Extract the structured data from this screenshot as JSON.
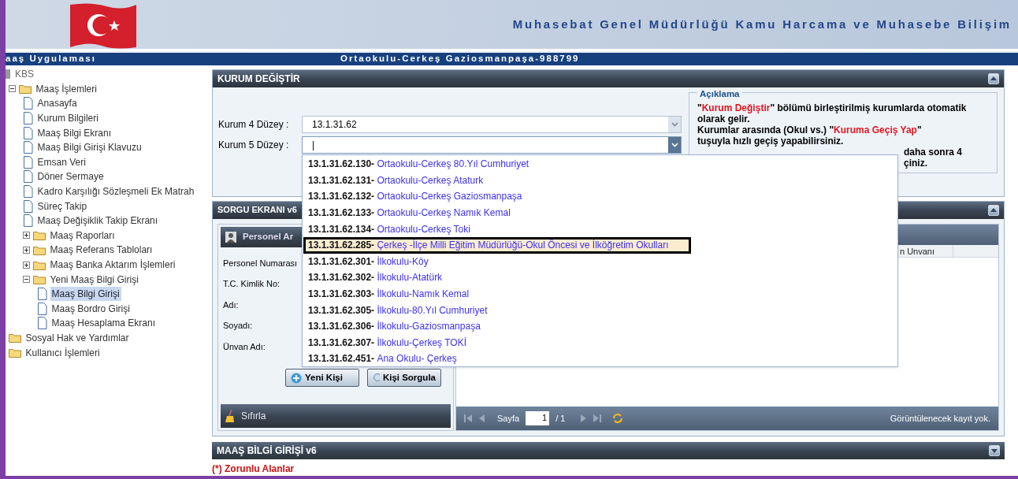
{
  "header": {
    "title": "Muhasebat Genel Müdürlüğü Kamu Harcama ve Muhasebe Bilişim"
  },
  "app_bar": {
    "app_name": "aaş Uygulaması",
    "institution": "Ortaokulu-Cerkeş Gaziosmanpaşa-988799"
  },
  "sidebar": {
    "tree": [
      {
        "label": "KBS",
        "kind": "root",
        "expanded": true,
        "children": [
          {
            "label": "Maaş İşlemleri",
            "kind": "folder",
            "expanded": true,
            "children": [
              {
                "label": "Anasayfa",
                "kind": "page",
                "selected": false
              },
              {
                "label": "Kurum Bilgileri",
                "kind": "page",
                "selected": false
              },
              {
                "label": "Maaş Bilgi Ekranı",
                "kind": "page",
                "selected": false
              },
              {
                "label": "Maaş Bilgi Girişi Klavuzu",
                "kind": "page",
                "selected": false
              },
              {
                "label": "Emsan Veri",
                "kind": "page",
                "selected": false
              },
              {
                "label": "Döner Sermaye",
                "kind": "page",
                "selected": false
              },
              {
                "label": "Kadro Karşılığı Sözleşmeli Ek Matrah",
                "kind": "page",
                "selected": false
              },
              {
                "label": "Süreç Takip",
                "kind": "page",
                "selected": false
              },
              {
                "label": "Maaş Değişiklik Takip Ekranı",
                "kind": "page",
                "selected": false
              },
              {
                "label": "Maaş Raporları",
                "kind": "folder",
                "expanded": false
              },
              {
                "label": "Maaş Referans Tabloları",
                "kind": "folder",
                "expanded": false
              },
              {
                "label": "Maaş Banka Aktarım İşlemleri",
                "kind": "folder",
                "expanded": false
              },
              {
                "label": "Yeni Maaş Bilgi Girişi",
                "kind": "folder",
                "expanded": true,
                "children": [
                  {
                    "label": "Maaş Bilgi Girişi",
                    "kind": "page",
                    "selected": true
                  },
                  {
                    "label": "Maaş Bordro Girişi",
                    "kind": "page",
                    "selected": false
                  },
                  {
                    "label": "Maaş Hesaplama Ekranı",
                    "kind": "page",
                    "selected": false
                  }
                ]
              }
            ]
          },
          {
            "label": "Sosyal Hak ve Yardımlar",
            "kind": "leaf-folder"
          },
          {
            "label": "Kullanıcı İşlemleri",
            "kind": "leaf-folder"
          }
        ]
      }
    ]
  },
  "kurum_panel": {
    "title": "KURUM DEĞİŞTİR",
    "fields": [
      {
        "label": "Kurum 4 Düzey :",
        "value": "13.1.31.62"
      },
      {
        "label": "Kurum 5 Düzey :",
        "value": "|"
      }
    ],
    "dropdown": [
      {
        "code": "13.1.31.62.130-",
        "name": "Ortaokulu-Cerkeş 80.Yıl Cumhuriyet",
        "selected": false
      },
      {
        "code": "13.1.31.62.131-",
        "name": "Ortaokulu-Cerkeş Ataturk",
        "selected": false
      },
      {
        "code": "13.1.31.62.132-",
        "name": "Ortaokulu-Cerkeş Gaziosmanpaşa",
        "selected": false
      },
      {
        "code": "13.1.31.62.133-",
        "name": "Ortaokulu-Cerkeş Namık Kemal",
        "selected": false
      },
      {
        "code": "13.1.31.62.134-",
        "name": "Ortaokulu-Cerkeş Toki",
        "selected": false
      },
      {
        "code": "13.1.31.62.285-",
        "name": "Çerkeş -İlçe Milli Eğitim Müdürlüğü-Okul Öncesi ve İlköğretim Okulları",
        "selected": true
      },
      {
        "code": "13.1.31.62.301-",
        "name": "İlkokulu-Köy",
        "selected": false
      },
      {
        "code": "13.1.31.62.302-",
        "name": "İlkokulu-Atatürk",
        "selected": false
      },
      {
        "code": "13.1.31.62.303-",
        "name": "İlkokulu-Namık Kemal",
        "selected": false
      },
      {
        "code": "13.1.31.62.305-",
        "name": "İlkokulu-80.Yıl Cumhuriyet",
        "selected": false
      },
      {
        "code": "13.1.31.62.306-",
        "name": "İlkokulu-Gaziosmanpaşa",
        "selected": false
      },
      {
        "code": "13.1.31.62.307-",
        "name": "İlkokulu-Çerkeş TOKİ",
        "selected": false
      },
      {
        "code": "13.1.31.62.451-",
        "name": "Ana Okulu- Çerkeş",
        "selected": false
      }
    ],
    "note": {
      "title": "Açıklama",
      "lines": [
        "\"**Kurum Değiştir**\" bölümü birleştirilmiş kurumlarda otomatik olarak gelir.",
        "Kurumlar arasında (Okul vs.) \"**Kuruma Geçiş Yap**\"",
        "tuşuyla hızlı geçiş yapabilirsiniz."
      ],
      "fragments": [
        "daha sonra 4",
        "çiniz."
      ]
    }
  },
  "sorgu_panel": {
    "title": "SORGU EKRANI v6",
    "search_title": "Personel Ar",
    "fields": [
      "Personel Numarası",
      "T.C. Kimlik No:",
      "Adı:",
      "Soyadı:",
      "Ünvan Adı:"
    ],
    "buttons": [
      {
        "label": "Yeni Kişi",
        "kind": "add"
      },
      {
        "label": "Kişi Sorgula",
        "kind": "search"
      }
    ],
    "reset": "Sıfırla",
    "column": "n Unvanı",
    "pager": {
      "page_label": "Sayfa",
      "page": "1",
      "total": "/ 1",
      "status": "Görüntülenecek kayıt yok."
    }
  },
  "maas_panel": {
    "title": "MAAŞ BİLGİ GİRİŞİ v6",
    "required_note": "(*) Zorunlu Alanlar"
  }
}
